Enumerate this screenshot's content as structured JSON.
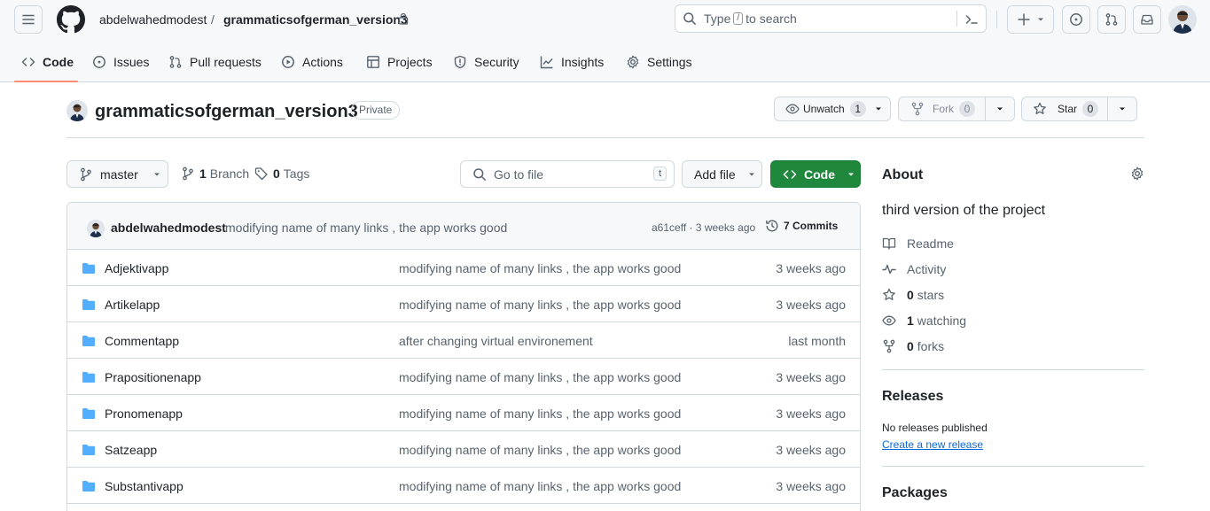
{
  "header": {
    "owner": "abdelwahedmodest",
    "separator": "/",
    "repo": "grammaticsofgerman_version3",
    "search_prefix": "Type",
    "search_key": "/",
    "search_suffix": "to search",
    "icons": [
      "menu-icon",
      "github-logo-icon",
      "lock-icon",
      "search-icon",
      "command-palette-icon",
      "plus-icon",
      "issues-icon",
      "pull-request-icon",
      "inbox-icon",
      "avatar"
    ]
  },
  "nav": {
    "tabs": [
      {
        "label": "Code",
        "icon": "code-icon",
        "active": true
      },
      {
        "label": "Issues",
        "icon": "issue-icon"
      },
      {
        "label": "Pull requests",
        "icon": "pull-request-icon"
      },
      {
        "label": "Actions",
        "icon": "play-icon"
      },
      {
        "label": "Projects",
        "icon": "table-icon"
      },
      {
        "label": "Security",
        "icon": "shield-icon"
      },
      {
        "label": "Insights",
        "icon": "graph-icon"
      },
      {
        "label": "Settings",
        "icon": "gear-icon"
      }
    ]
  },
  "repo": {
    "name": "grammaticsofgerman_version3",
    "visibility": "Private",
    "unwatch_label": "Unwatch",
    "watch_count": "1",
    "fork_label": "Fork",
    "fork_count": "0",
    "star_label": "Star",
    "star_count": "0"
  },
  "toolbar": {
    "branch": "master",
    "branch_count": "1",
    "branch_label": "Branch",
    "tag_count": "0",
    "tag_label": "Tags",
    "goto_placeholder": "Go to file",
    "goto_key": "t",
    "add_file": "Add file",
    "code_button": "Code"
  },
  "commit": {
    "author": "abdelwahedmodest",
    "message": "modifying name of many links , the app works good",
    "hash_age": "a61ceff · 3 weeks ago",
    "commits": "7 Commits"
  },
  "files": [
    {
      "name": "Adjektivapp",
      "message": "modifying name of many links , the app works good",
      "date": "3 weeks ago"
    },
    {
      "name": "Artikelapp",
      "message": "modifying name of many links , the app works good",
      "date": "3 weeks ago"
    },
    {
      "name": "Commentapp",
      "message": "after changing virtual environement",
      "date": "last month"
    },
    {
      "name": "Prapositionenapp",
      "message": "modifying name of many links , the app works good",
      "date": "3 weeks ago"
    },
    {
      "name": "Pronomenapp",
      "message": "modifying name of many links , the app works good",
      "date": "3 weeks ago"
    },
    {
      "name": "Satzeapp",
      "message": "modifying name of many links , the app works good",
      "date": "3 weeks ago"
    },
    {
      "name": "Substantivapp",
      "message": "modifying name of many links , the app works good",
      "date": "3 weeks ago"
    }
  ],
  "about": {
    "title": "About",
    "description": "third version of the project",
    "readme": "Readme",
    "activity": "Activity",
    "stars_count": "0",
    "stars_label": "stars",
    "watching_count": "1",
    "watching_label": "watching",
    "forks_count": "0",
    "forks_label": "forks"
  },
  "releases": {
    "title": "Releases",
    "none": "No releases published",
    "create_link": "Create a new release"
  },
  "packages": {
    "title": "Packages"
  },
  "colors": {
    "accent": "#0969da",
    "primary_button": "#1f883d",
    "folder": "#54aeff",
    "nav_underline": "#fd8c73"
  }
}
